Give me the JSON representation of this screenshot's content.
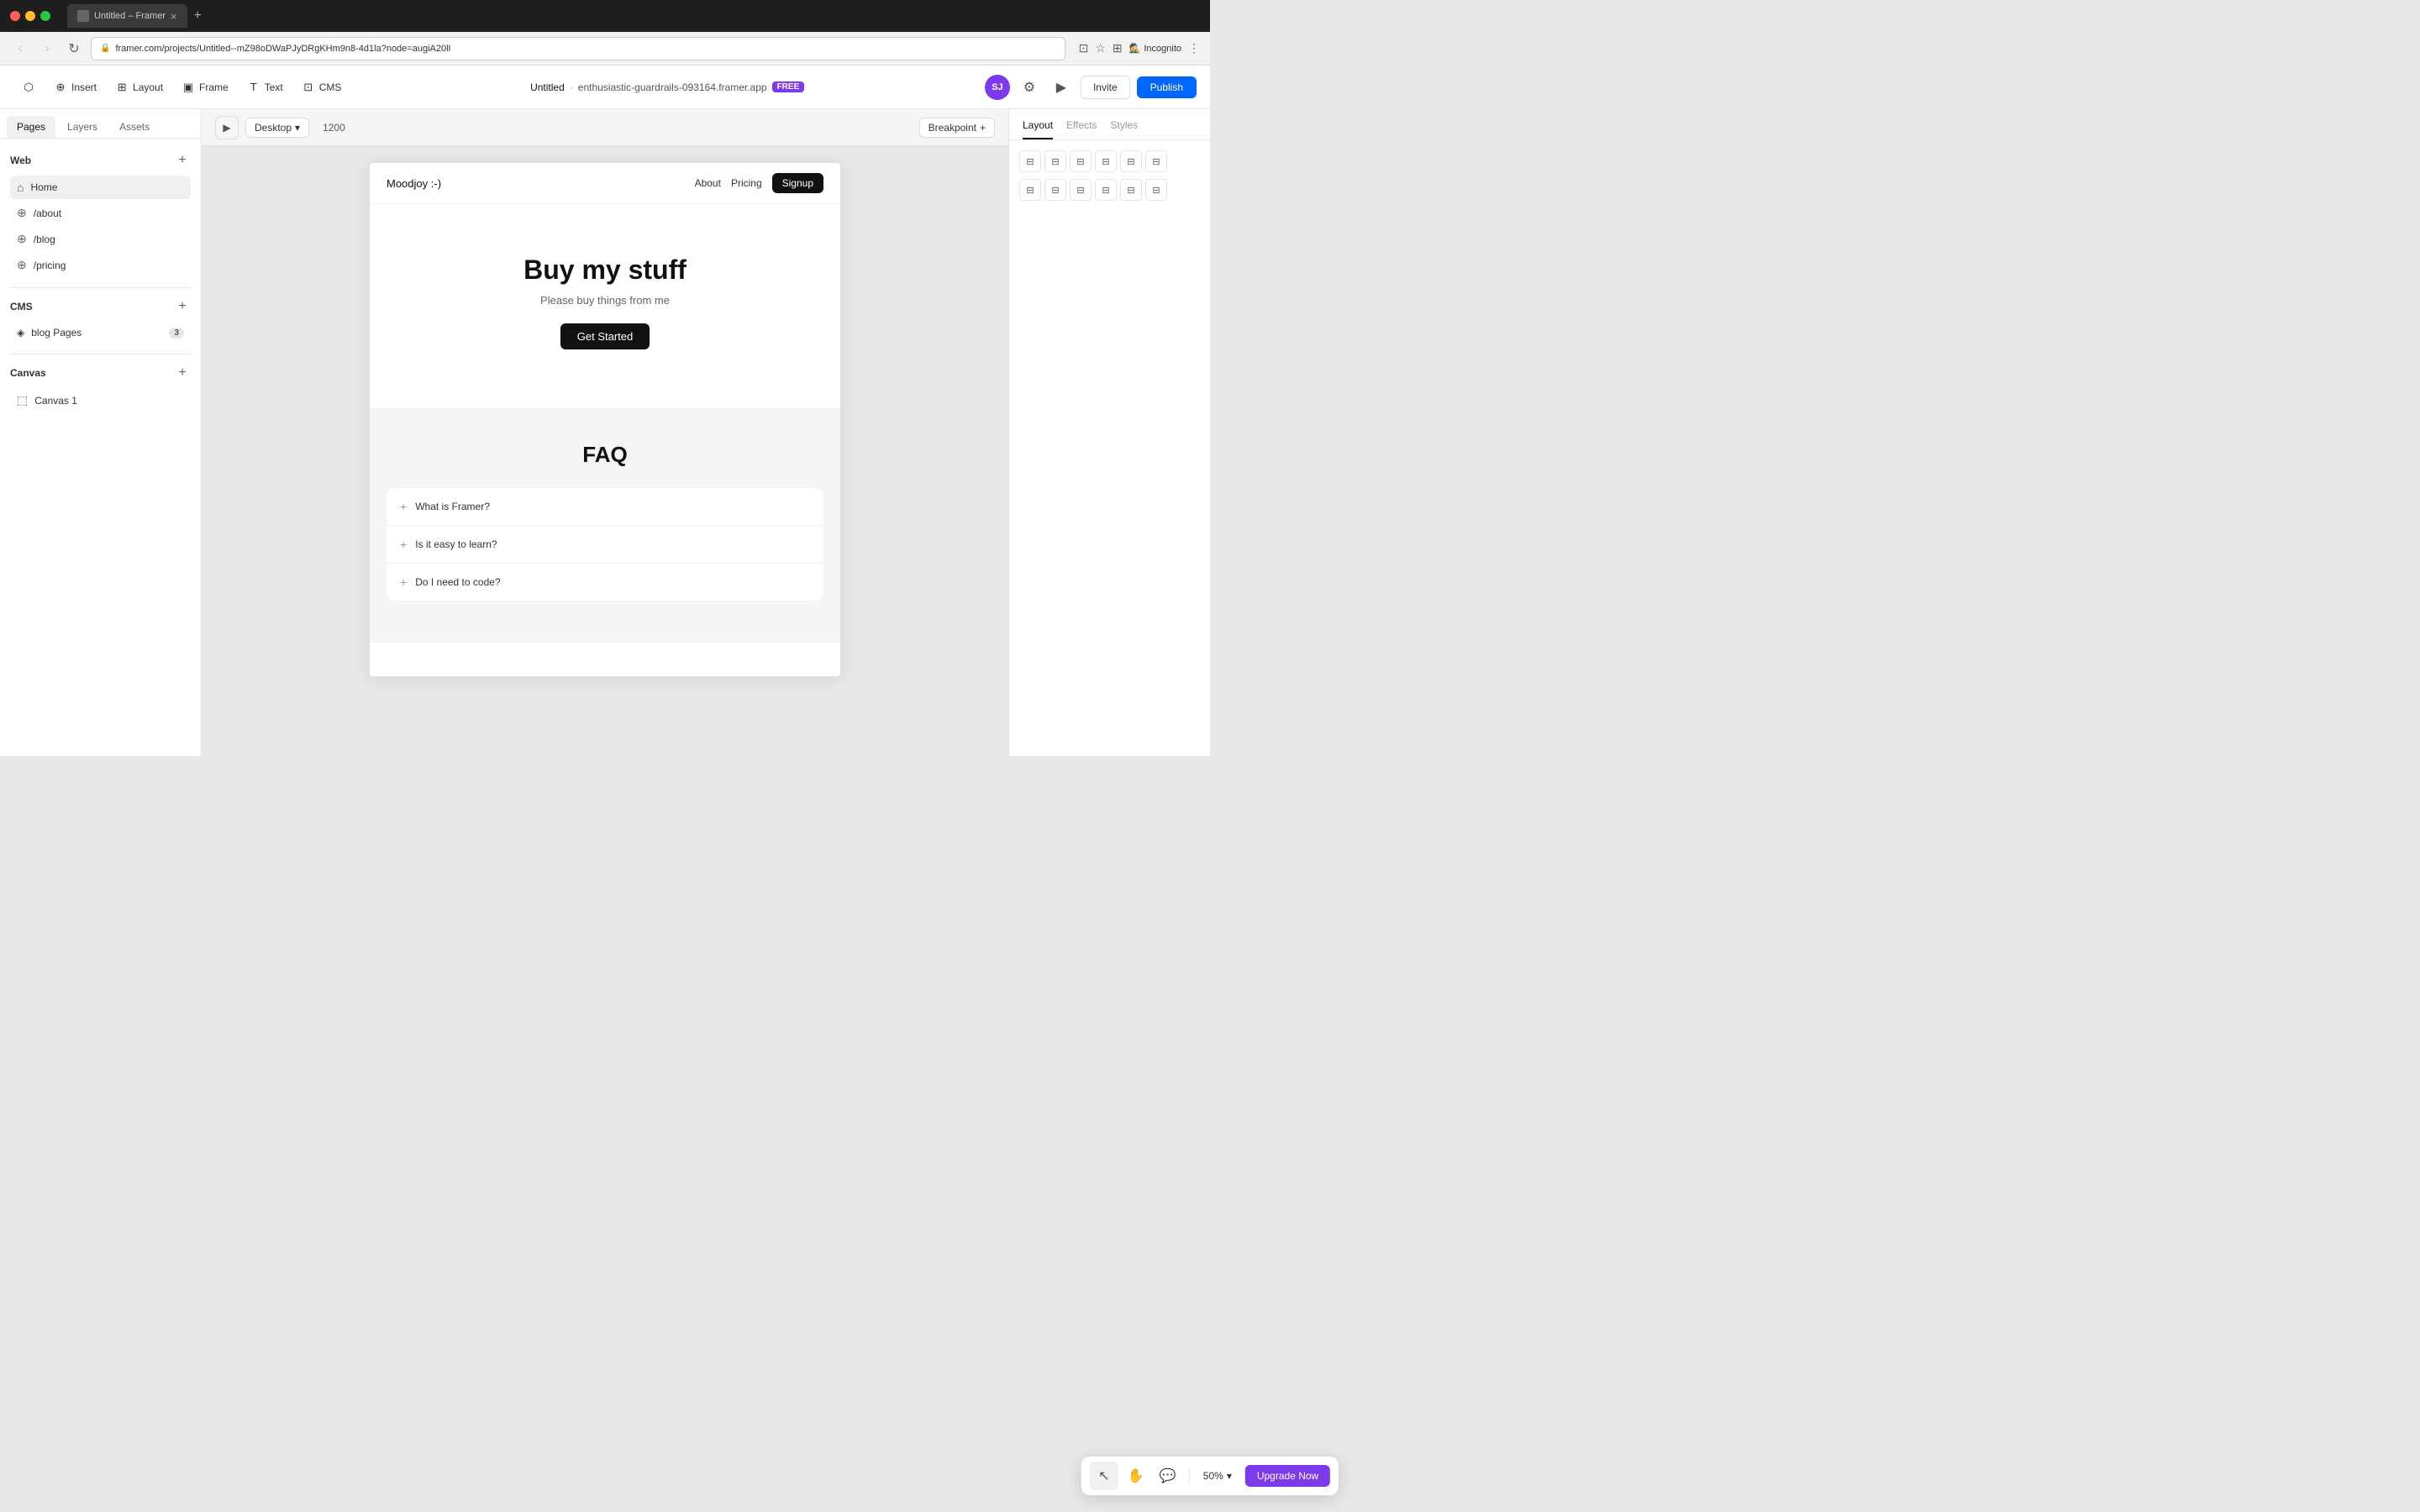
{
  "titlebar": {
    "tab_title": "Untitled – Framer",
    "close_label": "×",
    "new_tab_label": "+"
  },
  "addressbar": {
    "url": "framer.com/projects/Untitled--mZ98oDWaPJyDRgKHm9n8-4d1la?node=augiA20lI",
    "incognito_label": "Incognito"
  },
  "toolbar": {
    "insert_label": "Insert",
    "layout_label": "Layout",
    "frame_label": "Frame",
    "text_label": "Text",
    "cms_label": "CMS",
    "project_name": "Untitled",
    "separator": "·",
    "project_domain": "enthusiastic-guardrails-093164.framer.app",
    "free_badge": "FREE",
    "avatar": "SJ",
    "invite_label": "Invite",
    "publish_label": "Publish"
  },
  "sidebar": {
    "tabs": {
      "pages": "Pages",
      "layers": "Layers",
      "assets": "Assets"
    },
    "web_section": "Web",
    "pages": [
      {
        "label": "Home",
        "path": "",
        "icon": "home",
        "active": true
      },
      {
        "label": "/about",
        "path": "/about",
        "icon": "globe"
      },
      {
        "label": "/blog",
        "path": "/blog",
        "icon": "globe"
      },
      {
        "label": "/pricing",
        "path": "/pricing",
        "icon": "globe"
      }
    ],
    "cms_section": "CMS",
    "cms_items": [
      {
        "label": "blog Pages",
        "count": "3"
      }
    ],
    "canvas_section": "Canvas",
    "canvas_items": [
      {
        "label": "Canvas 1"
      }
    ]
  },
  "canvas": {
    "device": "Desktop",
    "width": "1200",
    "breakpoint_label": "Breakpoint",
    "preview_icon": "▶"
  },
  "website": {
    "logo": "Moodjoy :-)",
    "nav": {
      "about": "About",
      "pricing": "Pricing",
      "signup": "Signup"
    },
    "hero": {
      "title": "Buy my stuff",
      "subtitle": "Please buy things from me",
      "cta": "Get Started"
    },
    "faq": {
      "title": "FAQ",
      "items": [
        {
          "question": "What is Framer?"
        },
        {
          "question": "Is it easy to learn?"
        },
        {
          "question": "Do I need to code?"
        }
      ]
    }
  },
  "right_sidebar": {
    "tabs": [
      "Layout",
      "Effects",
      "Styles"
    ],
    "layout_icons": [
      [
        "⬛",
        "⬛",
        "⬛",
        "⬛",
        "⬛",
        "⬛"
      ],
      [
        "⬛",
        "⬛",
        "⬛",
        "⬛",
        "⬛",
        "⬛"
      ]
    ]
  },
  "bottom_toolbar": {
    "tools": [
      {
        "name": "select",
        "icon": "↖",
        "active": true
      },
      {
        "name": "hand",
        "icon": "✋"
      },
      {
        "name": "comment",
        "icon": "💬"
      }
    ],
    "zoom_label": "50%",
    "upgrade_label": "Upgrade Now"
  }
}
